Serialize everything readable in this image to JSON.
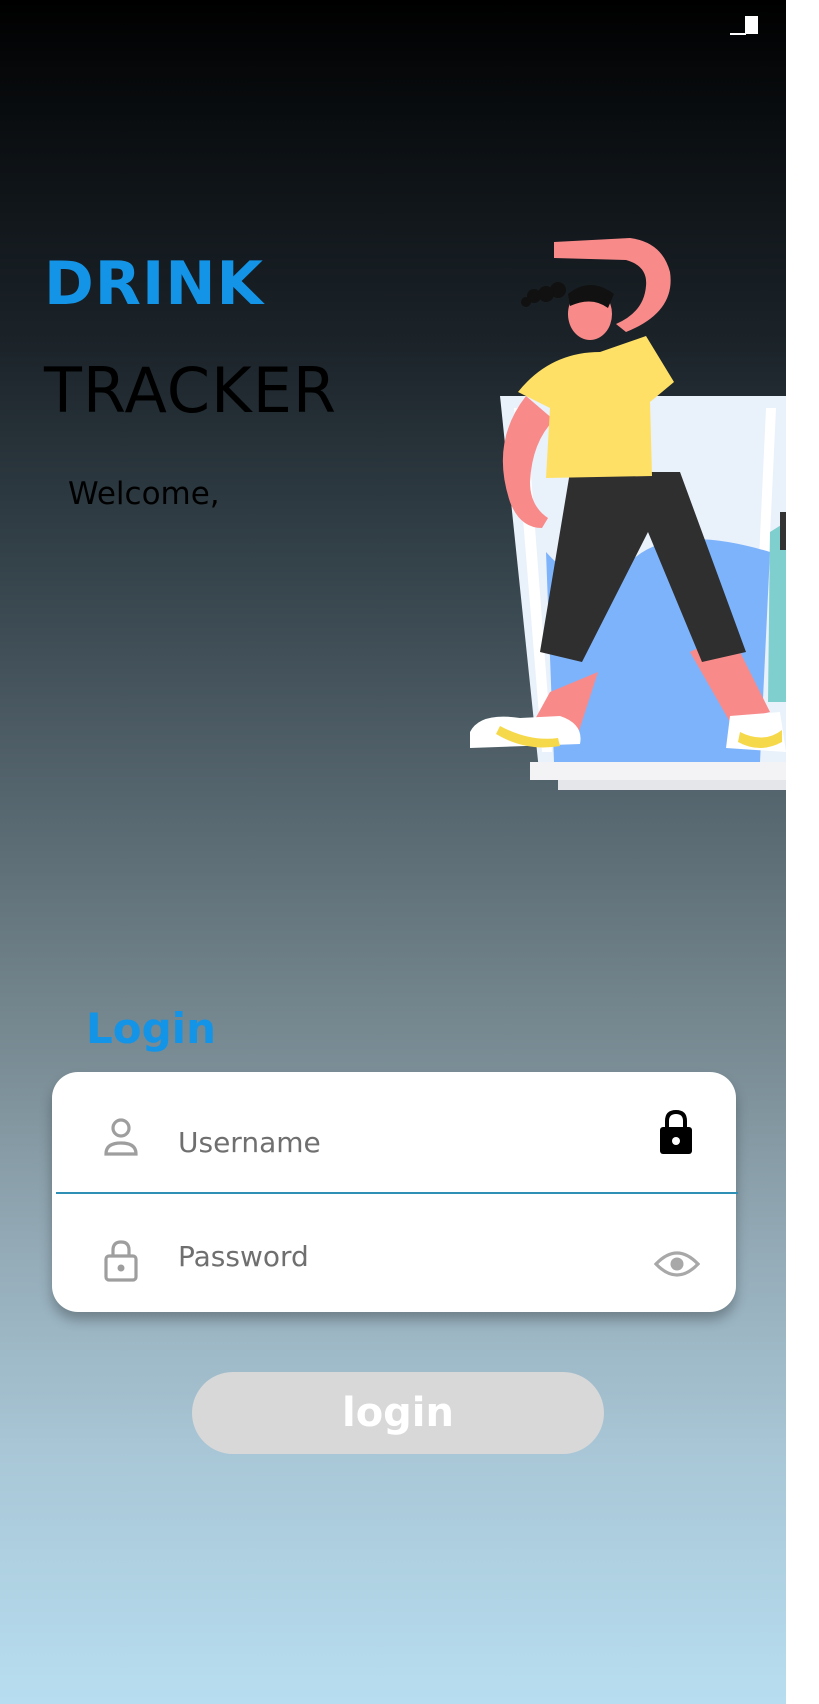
{
  "status_bar": {
    "battery_icon": "battery-icon"
  },
  "header": {
    "title_line1": "DRINK",
    "title_line2": "TRACKER",
    "greeting": "Welcome,"
  },
  "illustration": {
    "icon": "woman-on-water-glass-illustration"
  },
  "login_form": {
    "heading": "Login",
    "username": {
      "placeholder": "Username",
      "value": "",
      "leading_icon": "person-icon",
      "trailing_icon": "lock-icon"
    },
    "password": {
      "placeholder": "Password",
      "value": "",
      "leading_icon": "lock-outline-icon",
      "trailing_icon": "eye-icon"
    },
    "submit_label": "login"
  },
  "colors": {
    "accent": "#1494e6",
    "button_disabled": "#d8d8d8",
    "divider": "#2f8fb5"
  }
}
